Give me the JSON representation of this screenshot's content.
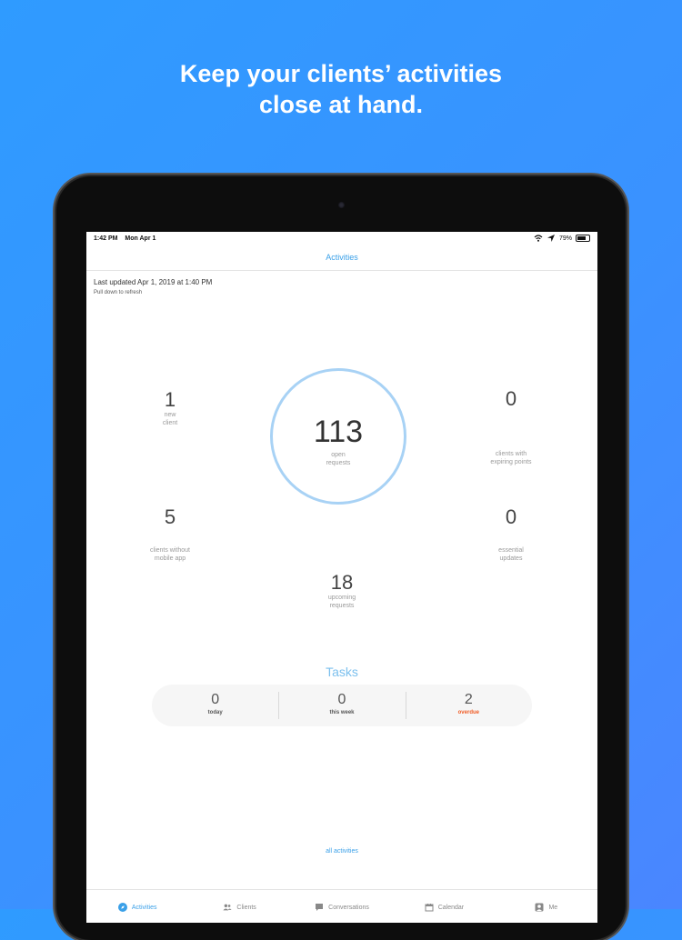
{
  "headline": {
    "line1": "Keep your clients’ activities",
    "line2": "close at hand."
  },
  "status": {
    "time": "1:42 PM",
    "date": "Mon Apr 1",
    "battery": "79%"
  },
  "nav": {
    "title": "Activities"
  },
  "updated": {
    "line1": "Last updated Apr 1, 2019 at 1:40 PM",
    "line2": "Pull down to refresh"
  },
  "stats": {
    "open_requests": {
      "value": "113",
      "label1": "open",
      "label2": "requests"
    },
    "new_client": {
      "value": "1",
      "label1": "new",
      "label2": "client"
    },
    "expiring_points": {
      "value": "0",
      "label1": "clients with",
      "label2": "expiring points"
    },
    "without_app": {
      "value": "5",
      "label1": "clients without",
      "label2": "mobile app"
    },
    "essential_updates": {
      "value": "0",
      "label1": "essential",
      "label2": "updates"
    },
    "upcoming_requests": {
      "value": "18",
      "label1": "upcoming",
      "label2": "requests"
    }
  },
  "tasks": {
    "title": "Tasks",
    "items": [
      {
        "value": "0",
        "label": "today"
      },
      {
        "value": "0",
        "label": "this week"
      },
      {
        "value": "2",
        "label": "overdue"
      }
    ]
  },
  "all_activities": "all activities",
  "tabs": [
    {
      "label": "Activities",
      "icon": "compass-icon",
      "active": true
    },
    {
      "label": "Clients",
      "icon": "people-icon",
      "active": false
    },
    {
      "label": "Conversations",
      "icon": "chat-bubble-icon",
      "active": false
    },
    {
      "label": "Calendar",
      "icon": "calendar-icon",
      "active": false
    },
    {
      "label": "Me",
      "icon": "person-icon",
      "active": false
    }
  ],
  "colors": {
    "accent": "#3aa0e8",
    "ring": "#a8d2f5",
    "overdue": "#f15b24",
    "background": "#3a92ff"
  }
}
